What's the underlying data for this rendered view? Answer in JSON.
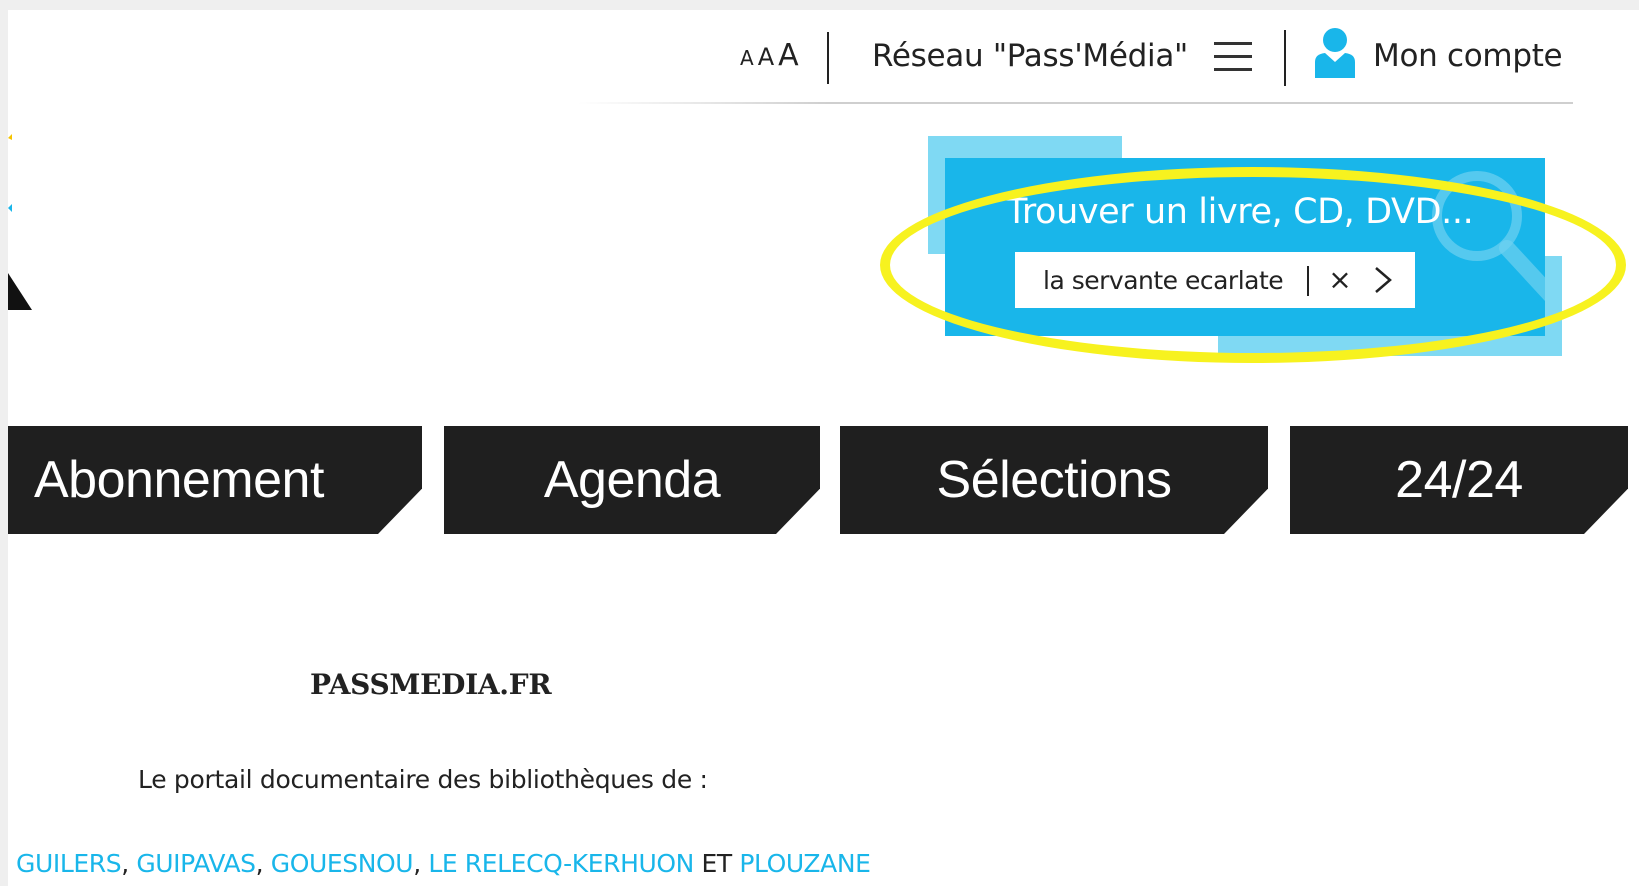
{
  "header": {
    "font_size": {
      "small": "A",
      "medium": "A",
      "large": "A"
    },
    "network_label": "Réseau \"Pass'Média\"",
    "menu_icon": "hamburger-menu-icon",
    "account_icon": "user-icon",
    "account_label": "Mon compte"
  },
  "search": {
    "title": "Trouver un livre, CD, DVD...",
    "value": "la servante ecarlate",
    "clear_label": "×",
    "submit_icon": "chevron-right-icon"
  },
  "nav": {
    "items": [
      {
        "label": "Abonnement"
      },
      {
        "label": "Agenda"
      },
      {
        "label": "Sélections"
      },
      {
        "label": "24/24"
      }
    ]
  },
  "content": {
    "site_name": "PASSMEDIA.FR",
    "portal_description": "Le portail documentaire des bibliothèques de :",
    "towns": [
      "GUILERS",
      "GUIPAVAS",
      "GOUESNOU",
      "LE RELECQ-KERHUON",
      "PLOUZANE"
    ],
    "separator": ", ",
    "conjunction": " ET "
  },
  "colors": {
    "accent": "#19b6ea",
    "accent_light": "#7fd9f3",
    "nav_background": "#1f1f1f",
    "highlight": "#f7f21f"
  }
}
